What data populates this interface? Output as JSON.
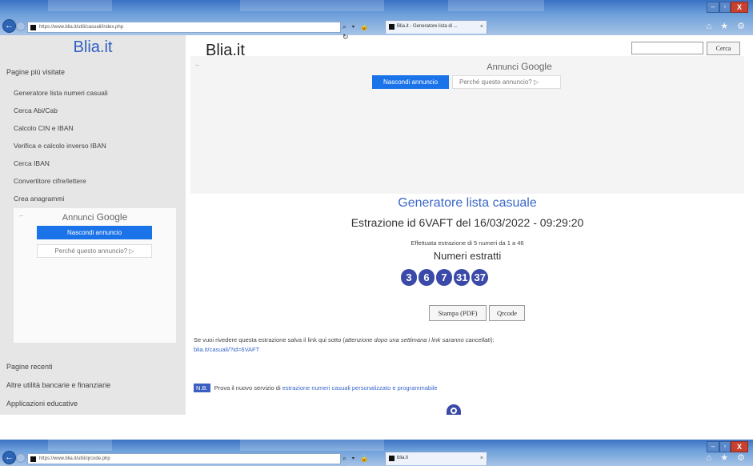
{
  "browser": {
    "url": "https://www.blia.it/utili/casuali/index.php",
    "tab_title": "Blia.it - Generatore lista di ...",
    "tab_close": "×",
    "back_glyph": "←",
    "addr_tools": "⌕ ▾ 🔒 ↻",
    "win_min": "–",
    "win_max": "▫",
    "win_close": "X",
    "right_icons": "⌂ ★ ⚙"
  },
  "sidebar": {
    "logo": "Blia.it",
    "most_visited": "Pagine più visitate",
    "links": [
      "Generatore lista numeri casuali",
      "Cerca Abi/Cab",
      "Calcolo CIN e IBAN",
      "Verifica e calcolo inverso IBAN",
      "Cerca IBAN",
      "Convertitore cifre/lettere",
      "Crea anagrammi"
    ],
    "recent": "Pagine recenti",
    "other_utils": "Altre utilità bancarie e finanziarie",
    "educational": "Applicazioni educative"
  },
  "ads": {
    "back": "←",
    "label": "Annunci",
    "google": "Google",
    "hide": "Nascondi annuncio",
    "why": "Perché questo annuncio? ▷"
  },
  "header": {
    "title": "Blia.it",
    "search_button": "Cerca",
    "search_value": ""
  },
  "main": {
    "gen_title": "Generatore lista casuale",
    "extract_heading": "Estrazione id 6VAFT del 16/03/2022 - 09:29:20",
    "extract_info": "Effettuata estrazione di 5 numeri da 1 a 46",
    "numbers_heading": "Numeri estratti",
    "numbers": [
      "3",
      "6",
      "7",
      "31",
      "37"
    ],
    "print_button": "Stampa (PDF)",
    "qr_button": "Qrcode",
    "save_note_prefix": "Se vuoi rivedere questa estrazione salva il link qui sotto (",
    "save_note_italic": "attenzione dopo una settimana i link saranno cancellati",
    "save_note_suffix": "):",
    "save_link": "blia.it/casuali/?id=6VAFT",
    "nb_tag": "N.B.",
    "nb_text": "Prova il nuovo servizio di",
    "nb_link": "estrazione numeri casuali personalizzato e programmabile"
  },
  "second_browser": {
    "url": "https://www.blia.it/utili/qrcode.php",
    "tab_title": "blia.it",
    "tab_close": "×"
  },
  "colors": {
    "accent": "#3a67c8",
    "ball": "#3b4aa8",
    "ad_button": "#1a73e8",
    "sidebar_bg": "#e6e6e6"
  }
}
